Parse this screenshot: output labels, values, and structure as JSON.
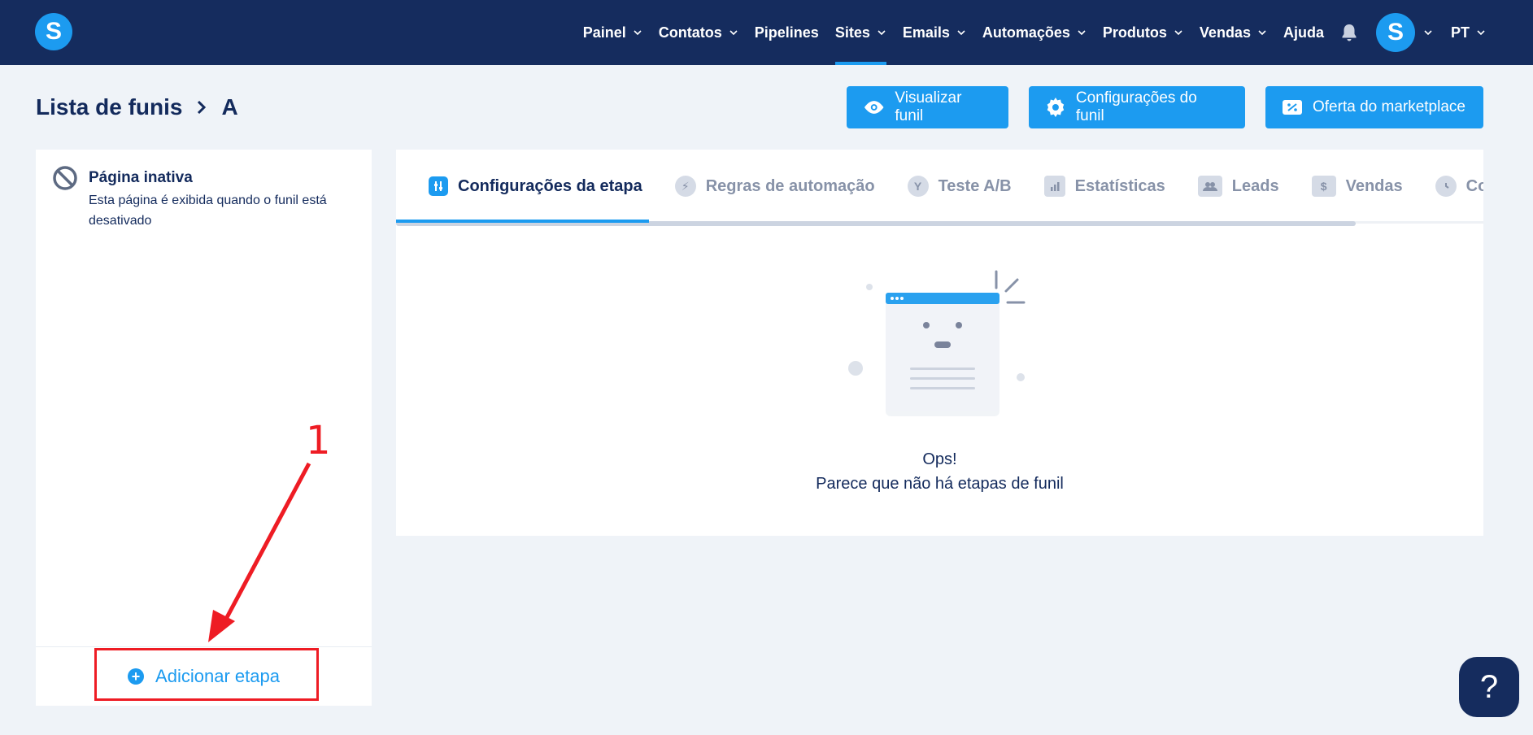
{
  "brand": {
    "logo_letter": "S"
  },
  "nav": {
    "items": [
      {
        "label": "Painel",
        "dropdown": true
      },
      {
        "label": "Contatos",
        "dropdown": true
      },
      {
        "label": "Pipelines",
        "dropdown": false
      },
      {
        "label": "Sites",
        "dropdown": true,
        "active": true
      },
      {
        "label": "Emails",
        "dropdown": true
      },
      {
        "label": "Automações",
        "dropdown": true
      },
      {
        "label": "Produtos",
        "dropdown": true
      },
      {
        "label": "Vendas",
        "dropdown": true
      },
      {
        "label": "Ajuda",
        "dropdown": false
      }
    ],
    "avatar_letter": "S",
    "language": "PT"
  },
  "breadcrumb": {
    "parent": "Lista de funis",
    "current": "A"
  },
  "actions": {
    "view_funnel": "Visualizar funil",
    "funnel_settings": "Configurações do funil",
    "marketplace_offer": "Oferta do marketplace"
  },
  "left_panel": {
    "inactive_title": "Página inativa",
    "inactive_desc": "Esta página é exibida quando o funil está desativado",
    "add_step": "Adicionar etapa"
  },
  "annotation": {
    "number": "1"
  },
  "tabs": [
    {
      "label": "Configurações da etapa",
      "icon": "sliders-icon",
      "active": true
    },
    {
      "label": "Regras de automação",
      "icon": "bolt-icon"
    },
    {
      "label": "Teste A/B",
      "icon": "split-icon"
    },
    {
      "label": "Estatísticas",
      "icon": "bar-chart-icon"
    },
    {
      "label": "Leads",
      "icon": "users-icon"
    },
    {
      "label": "Vendas",
      "icon": "dollar-icon"
    },
    {
      "label": "Config",
      "icon": "clock-icon"
    }
  ],
  "empty_state": {
    "title": "Ops!",
    "description": "Parece que não há etapas de funil"
  },
  "help": {
    "label": "?"
  },
  "colors": {
    "nav_bg": "#152c5e",
    "accent": "#1c9bf0",
    "annotation": "#ee1c24",
    "page_bg": "#eff3f8"
  }
}
